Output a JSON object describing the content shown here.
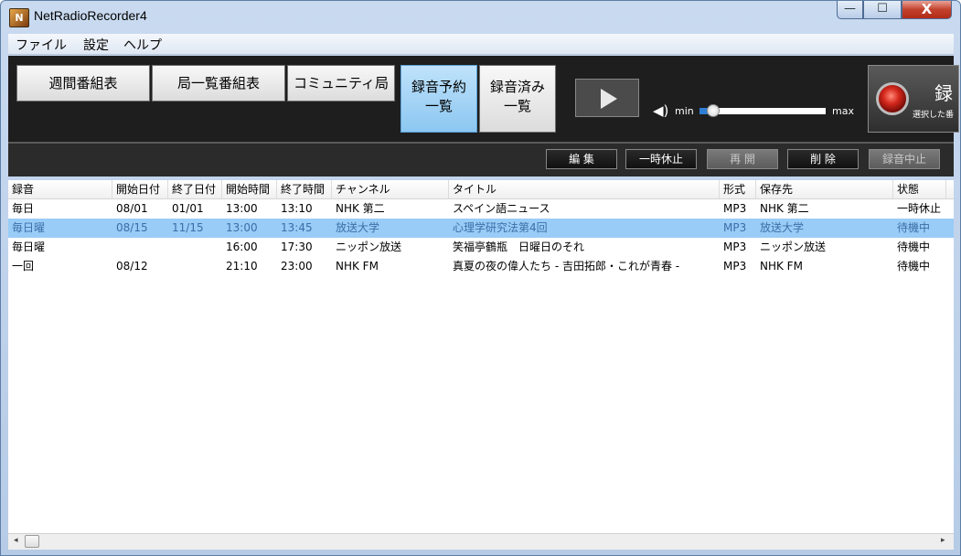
{
  "window": {
    "title": "NetRadioRecorder4",
    "app_icon_text": "N"
  },
  "window_buttons": {
    "minimize": "—",
    "maximize": "☐",
    "close": "X"
  },
  "menu": [
    "ファイル",
    "設定",
    "ヘルプ"
  ],
  "toolbar": {
    "weekly_schedule": "週間番組表",
    "station_list_schedule": "局一覧番組表",
    "community_station": "コミュニティ局",
    "reservation_list": {
      "line1": "録音予約",
      "line2": "一覧"
    },
    "recorded_list": {
      "line1": "録音済み",
      "line2": "一覧"
    },
    "volume": {
      "min_label": "min",
      "max_label": "max",
      "level": 0.11
    },
    "record_panel": {
      "label": "録",
      "sub": "選択した番"
    }
  },
  "actions": {
    "edit": "編 集",
    "pause": "一時休止",
    "resume": "再 開",
    "delete": "削 除",
    "stop_recording": "録音中止"
  },
  "list": {
    "columns": [
      "録音",
      "開始日付",
      "終了日付",
      "開始時間",
      "終了時間",
      "チャンネル",
      "タイトル",
      "形式",
      "保存先",
      "状態"
    ],
    "rows": [
      {
        "rec": "毎日",
        "start_date": "08/01",
        "end_date": "01/01",
        "start_time": "13:00",
        "end_time": "13:10",
        "channel": "NHK 第二",
        "title": "スペイン語ニュース",
        "format": "MP3",
        "dest": "NHK 第二",
        "status": "一時休止",
        "selected": false
      },
      {
        "rec": "毎日曜",
        "start_date": "08/15",
        "end_date": "11/15",
        "start_time": "13:00",
        "end_time": "13:45",
        "channel": "放送大学",
        "title": "心理学研究法第4回",
        "format": "MP3",
        "dest": "放送大学",
        "status": "待機中",
        "selected": true
      },
      {
        "rec": "毎日曜",
        "start_date": "",
        "end_date": "",
        "start_time": "16:00",
        "end_time": "17:30",
        "channel": "ニッポン放送",
        "title": "笑福亭鶴瓶　日曜日のそれ",
        "format": "MP3",
        "dest": "ニッポン放送",
        "status": "待機中",
        "selected": false
      },
      {
        "rec": "一回",
        "start_date": "08/12",
        "end_date": "",
        "start_time": "21:10",
        "end_time": "23:00",
        "channel": "NHK FM",
        "title": "真夏の夜の偉人たち - 吉田拓郎・これが青春 -",
        "format": "MP3",
        "dest": "NHK FM",
        "status": "待機中",
        "selected": false
      }
    ]
  },
  "scrollbar": {
    "left_arrow": "◂",
    "right_arrow": "▸"
  }
}
